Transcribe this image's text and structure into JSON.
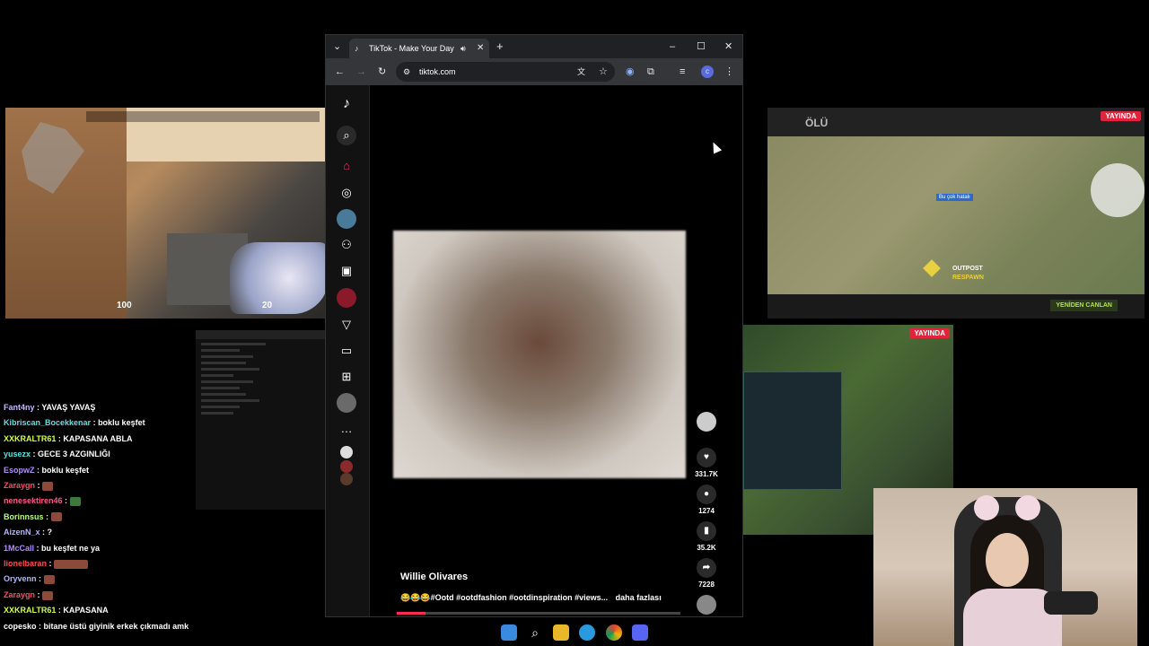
{
  "game_hud": {
    "health": "100",
    "ammo": "20"
  },
  "chat": [
    {
      "user": "Fant4ny",
      "color": "#c8b4ff",
      "text": "YAVAŞ YAVAŞ"
    },
    {
      "user": "Kibriscan_Bocekkenar",
      "color": "#5fe0e0",
      "text": "boklu keşfet"
    },
    {
      "user": "XXKRALTR61",
      "color": "#d4ff4a",
      "text": "KAPASANA ABLA"
    },
    {
      "user": "yusezx",
      "color": "#5fe0e0",
      "text": "GECE 3 AZGINLIĞI"
    },
    {
      "user": "EsopwZ",
      "color": "#b48cff",
      "text": "boklu keşfet"
    },
    {
      "user": "Zaraygn",
      "color": "#ff4a6a",
      "text": "",
      "emote": "emote"
    },
    {
      "user": "nenesektiren46",
      "color": "#ff5a8a",
      "text": "",
      "emote": "emote-green"
    },
    {
      "user": "Borinnsus",
      "color": "#b4ff7a",
      "text": "",
      "emote": "emote"
    },
    {
      "user": "AizenN_x",
      "color": "#b4b4ff",
      "text": "?"
    },
    {
      "user": "1McCall",
      "color": "#b48cff",
      "text": "bu keşfet ne ya"
    },
    {
      "user": "lionelbaran",
      "color": "#ff4a4a",
      "text": "",
      "emote": "emote-wide"
    },
    {
      "user": "Oryvenn",
      "color": "#b4b4ff",
      "text": "",
      "emote": "emote"
    },
    {
      "user": "Zaraygn",
      "color": "#ff4a6a",
      "text": "",
      "emote": "emote"
    },
    {
      "user": "XXKRALTR61",
      "color": "#d4ff4a",
      "text": "KAPASANA"
    },
    {
      "user": "copesko",
      "color": "#ffffff",
      "text": "bitane üstü giyinik erkek çıkmadı amk"
    }
  ],
  "browser": {
    "tab_title": "TikTok - Make Your Day",
    "url": "tiktok.com",
    "profile_initial": "c"
  },
  "tiktok": {
    "author": "Willie Olivares",
    "caption": "#Ootd #ootdfashion #ootdinspiration #views...",
    "more": "daha fazlası",
    "likes": "331.7K",
    "comments": "1274",
    "bookmarks": "35.2K",
    "shares": "7228",
    "progress": 0.1
  },
  "map": {
    "status": "ÖLÜ",
    "live": "YAYINDA",
    "location": "OUTPOST",
    "respawn": "RESPAWN",
    "respawn_button": "YENİDEN CANLAN",
    "marker": "Bu çok hatalı"
  },
  "lol": {
    "live": "YAYINDA"
  },
  "colors": {
    "tiktok_red": "#fe2c55",
    "live_red": "#e0243a",
    "chrome_bg": "#202124"
  }
}
